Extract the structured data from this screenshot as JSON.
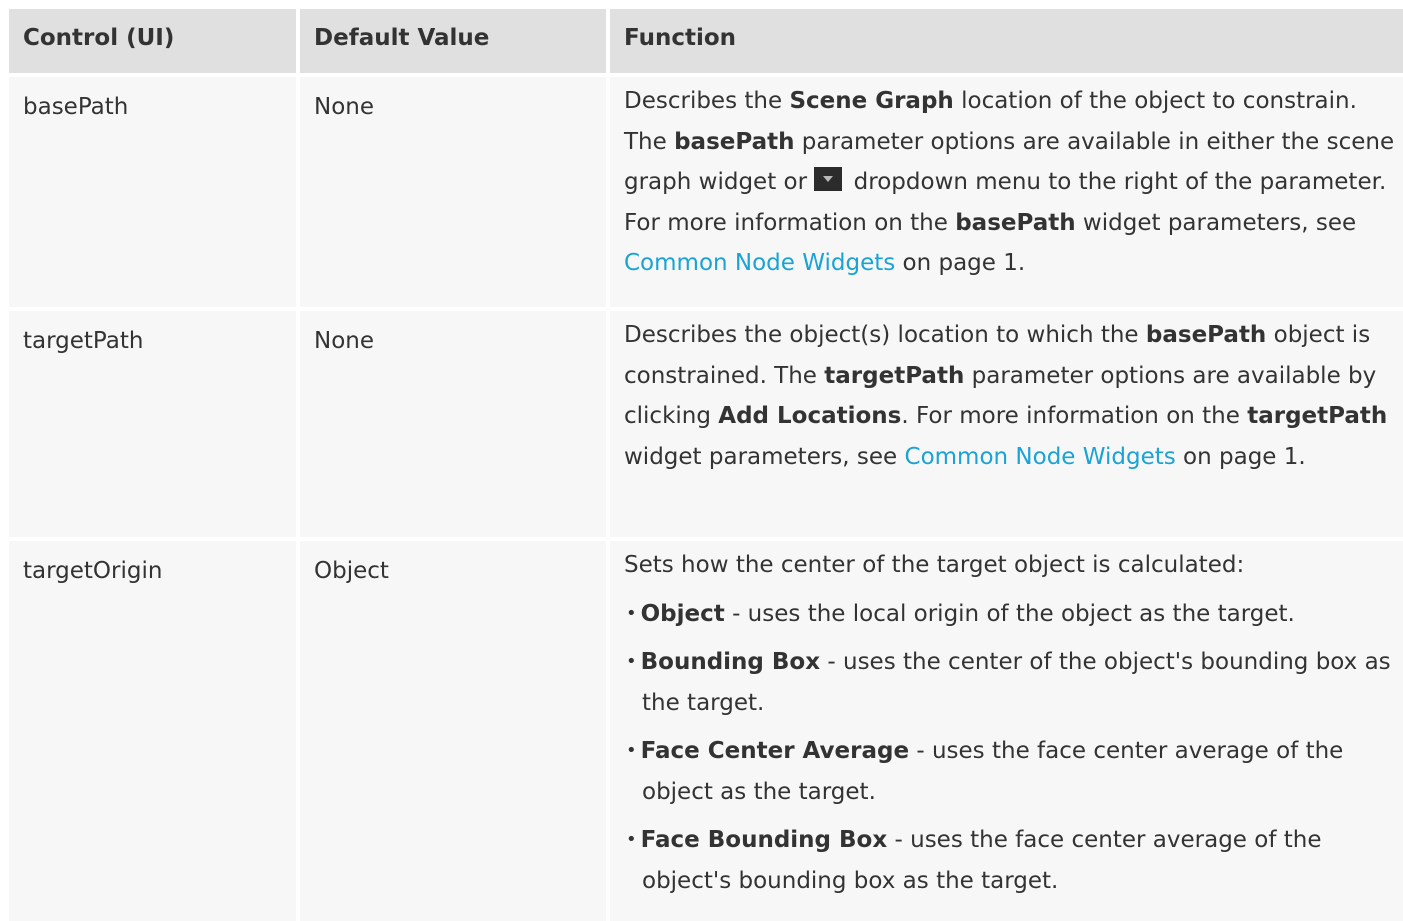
{
  "headers": {
    "control": "Control (UI)",
    "default": "Default Value",
    "function": "Function"
  },
  "rows": [
    {
      "control": "basePath",
      "default": "None",
      "func": {
        "t1": "Describes the ",
        "b1": "Scene Graph",
        "t2": " location of the object to constrain. The ",
        "b2": "basePath",
        "t3": " parameter options are available in either the scene graph widget or ",
        "t4": " dropdown menu to the right of the parameter. For more information on the ",
        "b3": "basePath",
        "t5": " widget parameters, see ",
        "link": "Common Node Widgets",
        "t6": " on page 1."
      }
    },
    {
      "control": "targetPath",
      "default": "None",
      "func": {
        "t1": "Describes the object(s) location to which the ",
        "b1": "basePath",
        "t2": " object is constrained. The ",
        "b2": "targetPath",
        "t3": " parameter options are available by clicking ",
        "b3": "Add Locations",
        "t4": ". For more information on the ",
        "b4": "targetPath",
        "t5": " widget parameters, see ",
        "link": "Common Node Widgets",
        "t6": " on page 1."
      }
    },
    {
      "control": "targetOrigin",
      "default": "Object",
      "func": {
        "intro": "Sets how the center of the target object is calculated:",
        "bullets": [
          {
            "term": "Object",
            "desc": " - uses the local origin of the object as the target."
          },
          {
            "term": "Bounding Box",
            "desc": " - uses the center of the object's bounding box as the target."
          },
          {
            "term": "Face Center Average",
            "desc": " - uses the face center average of the object as the target."
          },
          {
            "term": "Face Bounding Box",
            "desc": " - uses the face center average of the object's bounding box as the target."
          }
        ]
      }
    }
  ],
  "bullet_char": "•",
  "icons": {
    "dropdown": "dropdown-arrow-icon"
  },
  "colors": {
    "link": "#1aa3d4",
    "header_bg": "#e0e0e0",
    "row_bg": "#f7f7f7",
    "text": "#333333"
  }
}
